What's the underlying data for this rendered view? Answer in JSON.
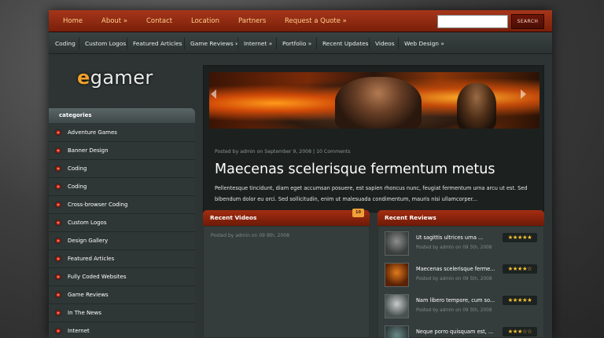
{
  "top_nav": {
    "items": [
      "Home",
      "About »",
      "Contact",
      "Location",
      "Partners",
      "Request a Quote »"
    ],
    "search_button": "SEARCH"
  },
  "cat_nav": {
    "items": [
      "Coding",
      "Custom Logos",
      "Featured Articles",
      "Game Reviews »",
      "Internet »",
      "Portfolio »",
      "Recent Updates",
      "Videos",
      "Web Design »"
    ]
  },
  "logo": {
    "prefix": "e",
    "text": "gamer"
  },
  "sidebar": {
    "heading": "categories",
    "items": [
      "Adventure Games",
      "Banner Design",
      "Coding",
      "Coding",
      "Cross-browser Coding",
      "Custom Logos",
      "Design Gallery",
      "Featured Articles",
      "Fully Coded Websites",
      "Game Reviews",
      "In The News",
      "Internet"
    ]
  },
  "feature": {
    "meta_prefix": "Posted by",
    "meta_author": "admin",
    "meta_on": "on",
    "meta_date": "September 9, 2008",
    "meta_sep": "|",
    "meta_comments": "10 Comments",
    "title": "Maecenas scelerisque fermentum metus",
    "excerpt": "Pellentesque tincidunt, diam eget accumsan posuere, est sapien rhoncus nunc, feugiat fermentum urna arcu ut est. Sed bibendum dolor eu orci. Sed sollicitudin, enim ut malesuada condimentum, mauris nisi ullamcorper..."
  },
  "recent_videos": {
    "heading": "Recent Videos",
    "badge": "10",
    "meta": "Posted by admin on 09 9th, 2008"
  },
  "recent_reviews": {
    "heading": "Recent Reviews",
    "items": [
      {
        "title": "Ut sagittis ultrices urna ...",
        "meta": "Posted by admin on 09 5th, 2008",
        "stars": "★★★★★"
      },
      {
        "title": "Maecenas scelerisque ferme...",
        "meta": "Posted by admin on 09 5th, 2008",
        "stars": "★★★★☆"
      },
      {
        "title": "Nam libero tempore, cum so...",
        "meta": "Posted by admin on 09 5th, 2008",
        "stars": "★★★★★"
      },
      {
        "title": "Neque porro quisquam est, ...",
        "meta": "",
        "stars": "★★★☆☆"
      }
    ]
  },
  "colors": {
    "accent": "#a6361a",
    "link_orange": "#ffd08a",
    "star_gold": "#f6c233"
  }
}
